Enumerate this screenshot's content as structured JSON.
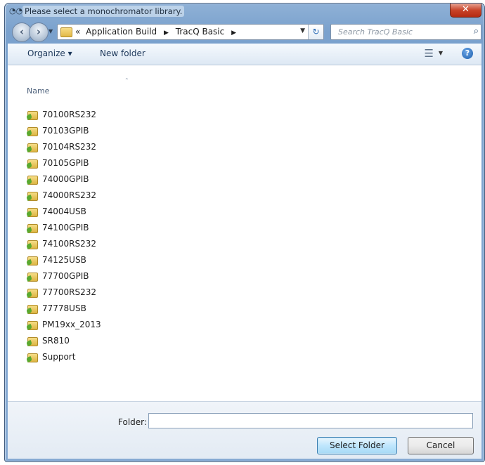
{
  "window": {
    "title": "Please select a monochromator library."
  },
  "navbar": {
    "breadcrumb": [
      "«",
      "Application Build",
      "TracQ Basic"
    ],
    "search_placeholder": "Search TracQ Basic"
  },
  "toolbar": {
    "organize_label": "Organize ▾",
    "new_folder_label": "New folder"
  },
  "list": {
    "column_header": "Name",
    "items": [
      {
        "label": "70100RS232"
      },
      {
        "label": "70103GPIB"
      },
      {
        "label": "70104RS232"
      },
      {
        "label": "70105GPIB"
      },
      {
        "label": "74000GPIB"
      },
      {
        "label": "74000RS232"
      },
      {
        "label": "74004USB"
      },
      {
        "label": "74100GPIB"
      },
      {
        "label": "74100RS232"
      },
      {
        "label": "74125USB"
      },
      {
        "label": "77700GPIB"
      },
      {
        "label": "77700RS232"
      },
      {
        "label": "77778USB"
      },
      {
        "label": "PM19xx_2013"
      },
      {
        "label": "SR810"
      },
      {
        "label": "Support"
      }
    ]
  },
  "footer": {
    "folder_label": "Folder:",
    "folder_value": "",
    "select_button": "Select Folder",
    "cancel_button": "Cancel"
  },
  "icons": {
    "folder": "folder-icon",
    "search": "search-icon",
    "help": "help-icon",
    "close": "close-icon"
  }
}
